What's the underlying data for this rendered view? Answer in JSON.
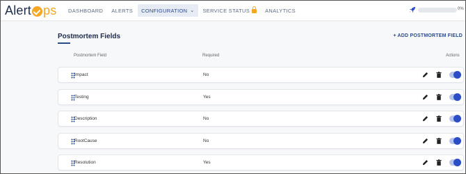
{
  "brand": {
    "logo_prefix": "Alert",
    "logo_suffix": "ps"
  },
  "nav": {
    "items": [
      {
        "label": "DASHBOARD"
      },
      {
        "label": "ALERTS"
      },
      {
        "label": "CONFIGURATION"
      },
      {
        "label": "SERVICE STATUS"
      },
      {
        "label": "ANALYTICS"
      }
    ],
    "active": "CONFIGURATION"
  },
  "onboarding": {
    "progress_label": "0%",
    "progress_fraction": 0
  },
  "page": {
    "title": "Postmortem Fields",
    "add_button": "+ ADD POSTMORTEM FIELD"
  },
  "table": {
    "columns": {
      "field": "Postmortem Field",
      "required": "Required",
      "actions": "Actions"
    },
    "rows": [
      {
        "field": "Impact",
        "required": "No",
        "enabled": true
      },
      {
        "field": "Testing",
        "required": "Yes",
        "enabled": true
      },
      {
        "field": "Description",
        "required": "No",
        "enabled": true
      },
      {
        "field": "RootCause",
        "required": "No",
        "enabled": true
      },
      {
        "field": "Resolution",
        "required": "Yes",
        "enabled": true
      }
    ]
  },
  "colors": {
    "accent": "#2b4a8a",
    "brand_orange": "#f5a623",
    "toggle_on": "#2b4ec6"
  }
}
